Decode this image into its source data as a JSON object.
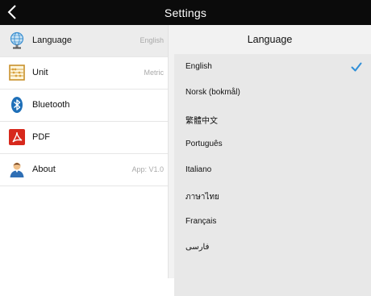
{
  "header": {
    "title": "Settings",
    "back_icon": "chevron-left-icon"
  },
  "menu": {
    "items": [
      {
        "label": "Language",
        "value": "English",
        "icon": "globe-icon",
        "selected": true
      },
      {
        "label": "Unit",
        "value": "Metric",
        "icon": "abacus-icon",
        "selected": false
      },
      {
        "label": "Bluetooth",
        "value": "",
        "icon": "bluetooth-icon",
        "selected": false
      },
      {
        "label": "PDF",
        "value": "",
        "icon": "pdf-icon",
        "selected": false
      },
      {
        "label": "About",
        "value": "App: V1.0",
        "icon": "user-icon",
        "selected": false
      }
    ]
  },
  "language_panel": {
    "title": "Language",
    "options": [
      {
        "label": "English",
        "checked": true
      },
      {
        "label": "Norsk (bokmål)",
        "checked": false
      },
      {
        "label": "繁體中文",
        "checked": false
      },
      {
        "label": "Português",
        "checked": false
      },
      {
        "label": "Italiano",
        "checked": false
      },
      {
        "label": "ภาษาไทย",
        "checked": false
      },
      {
        "label": "Français",
        "checked": false
      },
      {
        "label": "فارسی",
        "checked": false
      }
    ]
  },
  "colors": {
    "header_bg": "#0b0b0b",
    "check_accent": "#2f8fd8",
    "selected_row_bg": "#ececec"
  }
}
